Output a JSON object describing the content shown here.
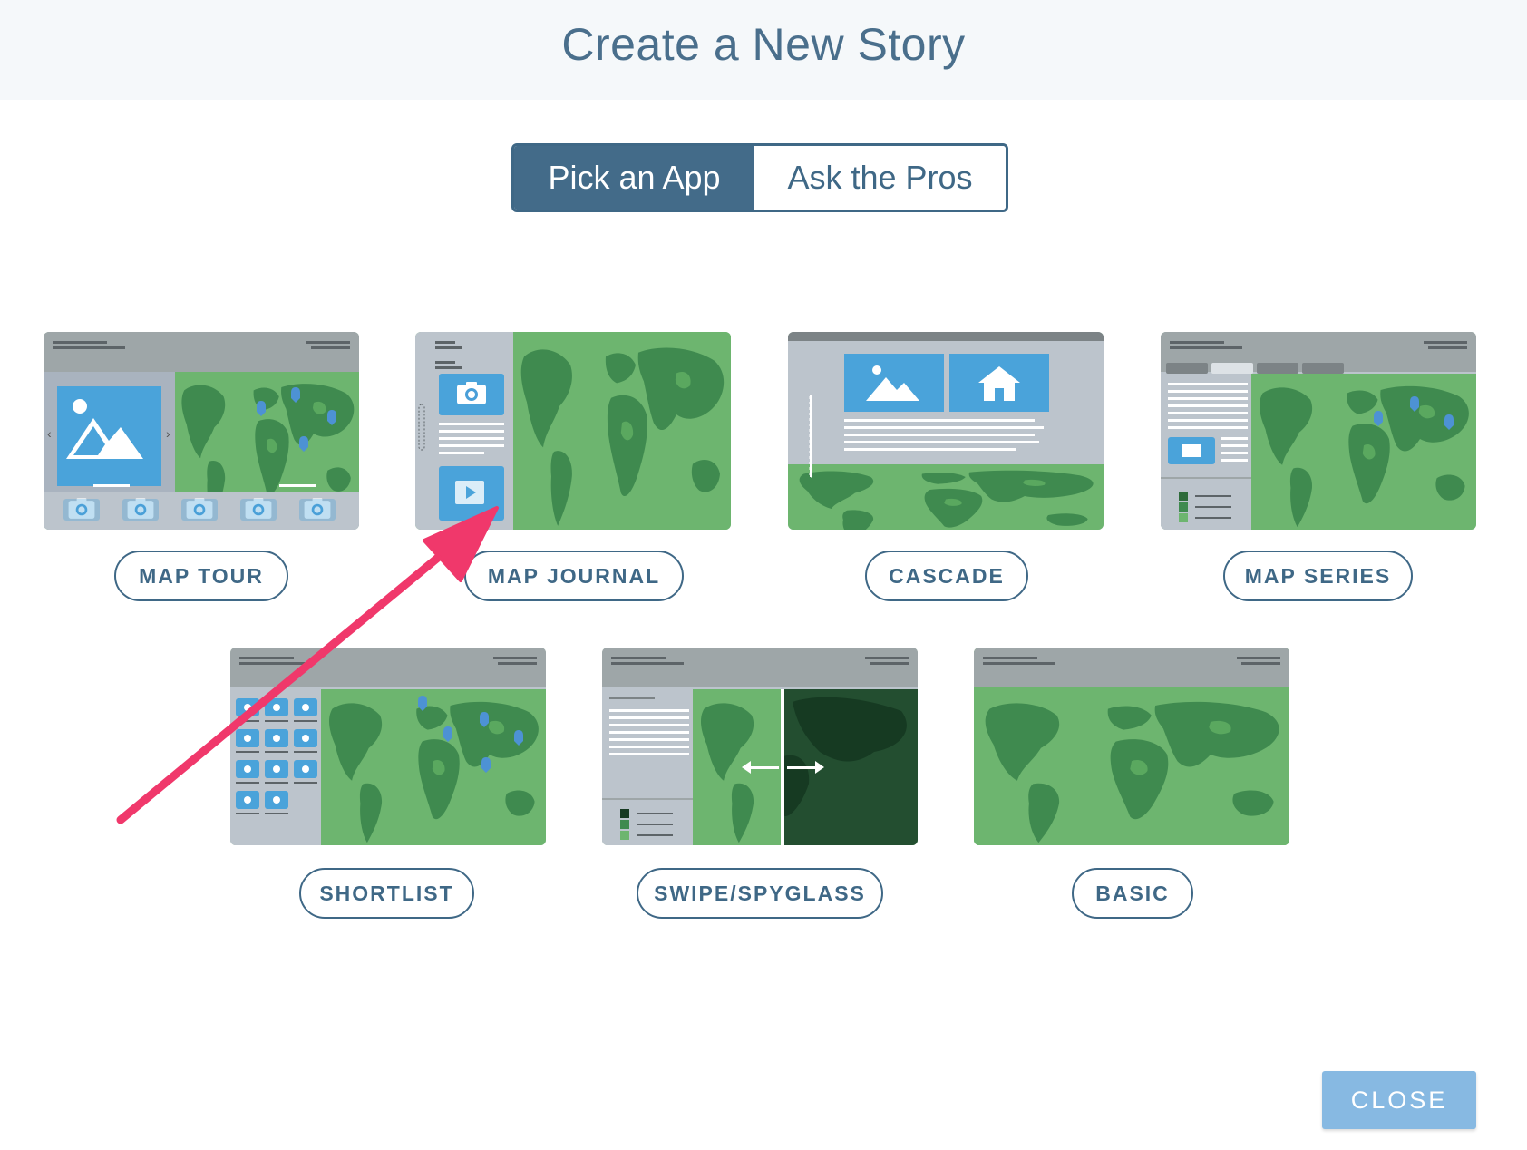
{
  "dialog": {
    "title": "Create a New Story"
  },
  "tabs": {
    "pick_app": "Pick an App",
    "ask_pros": "Ask the Pros",
    "active": "pick_app"
  },
  "apps": [
    {
      "label": "MAP TOUR"
    },
    {
      "label": "MAP JOURNAL"
    },
    {
      "label": "CASCADE"
    },
    {
      "label": "MAP SERIES"
    },
    {
      "label": "SHORTLIST"
    },
    {
      "label": "SWIPE/SPYGLASS"
    },
    {
      "label": "BASIC"
    }
  ],
  "footer": {
    "close_label": "CLOSE"
  },
  "colors": {
    "accent": "#436b89",
    "close_button": "#87b9e2",
    "annotation_arrow": "#f0386b",
    "map_land_light": "#6db56f",
    "map_land_dark": "#3f8a4f"
  },
  "annotation": {
    "type": "arrow",
    "points_to": "MAP JOURNAL"
  }
}
